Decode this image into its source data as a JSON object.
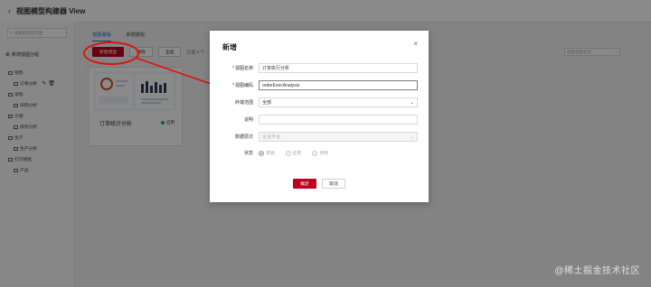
{
  "header": {
    "back_icon": "chevron-left-icon",
    "title": "视图模型构建器 View"
  },
  "sidebar": {
    "search_placeholder": "搜索模块或页面",
    "add_group_label": "新增视图分组",
    "tree": [
      {
        "label": "销售",
        "type": "group"
      },
      {
        "label": "订单分析",
        "type": "item"
      },
      {
        "label": "采购",
        "type": "group"
      },
      {
        "label": "采购分析",
        "type": "item"
      },
      {
        "label": "仓储",
        "type": "group"
      },
      {
        "label": "库存分析",
        "type": "item"
      },
      {
        "label": "生产",
        "type": "group"
      },
      {
        "label": "生产分析",
        "type": "item"
      },
      {
        "label": "打印模板",
        "type": "group"
      },
      {
        "label": "产品",
        "type": "item"
      }
    ]
  },
  "main": {
    "tabs": [
      {
        "label": "视图看板",
        "active": true
      },
      {
        "label": "单据模板",
        "active": false
      }
    ],
    "toolbar": {
      "new_label": "新建模型",
      "delete_label": "删除",
      "select_all_label": "全选",
      "selected_text": "已选 0 个"
    },
    "search_placeholder": "搜索视图名称",
    "card": {
      "name": "订单统计分析",
      "status": "启用",
      "status_color": "#19b26b"
    }
  },
  "modal": {
    "title": "新增",
    "close_icon": "close-icon",
    "fields": {
      "view_name": {
        "label": "视图名称",
        "value": "订单执行分析",
        "required": true
      },
      "view_code": {
        "label": "视图编码",
        "value": "orderExecAnalysis",
        "required": true
      },
      "terminal_scope": {
        "label": "终端范围",
        "value": "全部"
      },
      "description": {
        "label": "说明",
        "value": ""
      },
      "data_level": {
        "label": "数据层次",
        "value": "企业平台"
      },
      "status": {
        "label": "状态",
        "options": [
          "草稿",
          "启用",
          "停用"
        ],
        "selected": "草稿"
      }
    },
    "confirm_label": "确定",
    "cancel_label": "取消"
  },
  "watermark": "@稀土掘金技术社区",
  "colors": {
    "brand": "#c0001e",
    "tab_active": "#2f6fd6",
    "annotation": "#e01010"
  }
}
